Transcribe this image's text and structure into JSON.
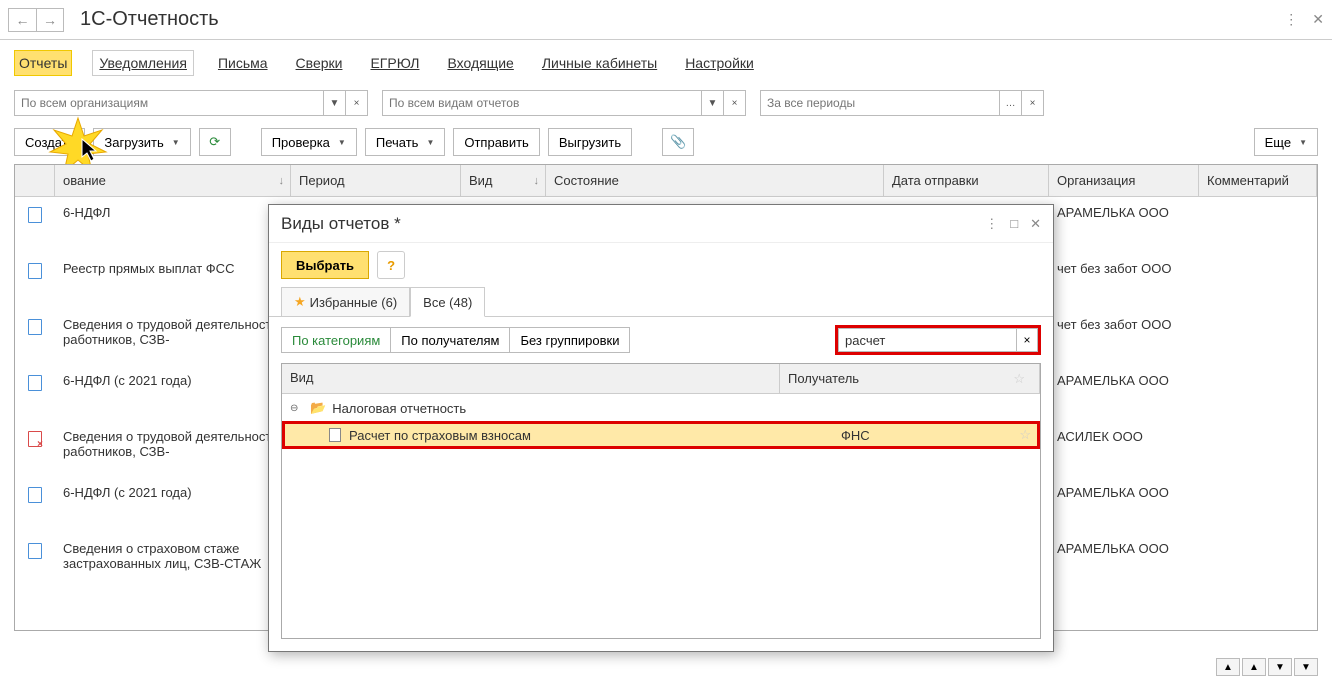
{
  "app_title": "1С-Отчетность",
  "tabs": [
    "Отчеты",
    "Уведомления",
    "Письма",
    "Сверки",
    "ЕГРЮЛ",
    "Входящие",
    "Личные кабинеты",
    "Настройки"
  ],
  "filters": {
    "org_placeholder": "По всем организациям",
    "type_placeholder": "По всем видам отчетов",
    "period_placeholder": "За все периоды"
  },
  "toolbar": {
    "create": "Создать",
    "load": "Загрузить",
    "check": "Проверка",
    "print": "Печать",
    "send": "Отправить",
    "export": "Выгрузить",
    "more": "Еще"
  },
  "columns": {
    "name": "ование",
    "period": "Период",
    "type": "Вид",
    "status": "Состояние",
    "date": "Дата отправки",
    "org": "Организация",
    "comment": "Комментарий"
  },
  "rows": [
    {
      "name": "6-НДФЛ",
      "org": "АРАМЕЛЬКА ООО"
    },
    {
      "name": "Реестр прямых выплат ФСС",
      "org": "чет без забот ООО"
    },
    {
      "name": "Сведения о трудовой деятельности работников, СЗВ-",
      "org": "чет без забот ООО"
    },
    {
      "name": "6-НДФЛ (с 2021 года)",
      "org": "АРАМЕЛЬКА ООО"
    },
    {
      "name": "Сведения о трудовой деятельности работников, СЗВ-",
      "org": "АСИЛЕК ООО",
      "red": true
    },
    {
      "name": "6-НДФЛ (с 2021 года)",
      "org": "АРАМЕЛЬКА ООО"
    },
    {
      "name": "Сведения о страховом стаже застрахованных лиц, СЗВ-СТАЖ",
      "org": "АРАМЕЛЬКА ООО"
    }
  ],
  "modal": {
    "title": "Виды отчетов *",
    "select": "Выбрать",
    "tab_fav": "Избранные (6)",
    "tab_all": "Все (48)",
    "seg": [
      "По категориям",
      "По получателям",
      "Без группировки"
    ],
    "search_value": "расчет",
    "col_type": "Вид",
    "col_recv": "Получатель",
    "folder": "Налоговая отчетность",
    "item_name": "Расчет по страховым взносам",
    "item_recv": "ФНС"
  }
}
